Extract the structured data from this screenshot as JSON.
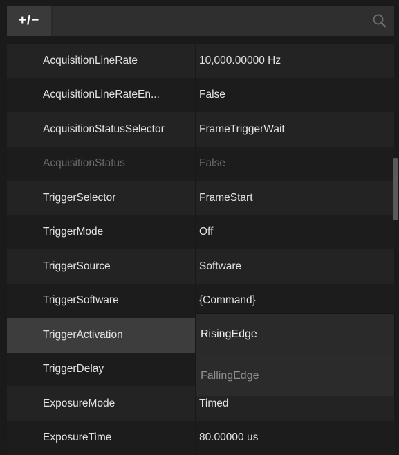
{
  "toolbar": {
    "expand_collapse_label": "+/−",
    "search_placeholder": ""
  },
  "properties": [
    {
      "name": "AcquisitionLineRate",
      "value": "10,000.00000 Hz",
      "enabled": true
    },
    {
      "name": "AcquisitionLineRateEn...",
      "value": "False",
      "enabled": true
    },
    {
      "name": "AcquisitionStatusSelector",
      "value": "FrameTriggerWait",
      "enabled": true
    },
    {
      "name": "AcquisitionStatus",
      "value": "False",
      "enabled": false
    },
    {
      "name": "TriggerSelector",
      "value": "FrameStart",
      "enabled": true
    },
    {
      "name": "TriggerMode",
      "value": "Off",
      "enabled": true
    },
    {
      "name": "TriggerSource",
      "value": "Software",
      "enabled": true
    },
    {
      "name": "TriggerSoftware",
      "value": "{Command}",
      "enabled": true
    },
    {
      "name": "TriggerActivation",
      "value": "",
      "enabled": true,
      "selected": true
    },
    {
      "name": "TriggerDelay",
      "value": "",
      "enabled": true
    },
    {
      "name": "ExposureMode",
      "value": "Timed",
      "enabled": true
    },
    {
      "name": "ExposureTime",
      "value": "80.00000 us",
      "enabled": true
    }
  ],
  "dropdown": {
    "options": [
      "RisingEdge",
      "FallingEdge"
    ],
    "selected": "RisingEdge"
  },
  "colors": {
    "background": "#1a1a1a",
    "row_alt": "#232323",
    "selected_row": "#3d3d3d",
    "disabled_text": "#6a6a6a"
  }
}
